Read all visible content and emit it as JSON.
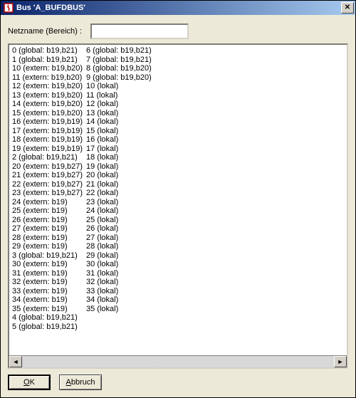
{
  "window": {
    "title": "Bus 'A_BUFDBUS'"
  },
  "form": {
    "netname_label": "Netzname (Bereich) :",
    "netname_value": ""
  },
  "list": {
    "col1": [
      "0 (global: b19,b21)",
      "1 (global: b19,b21)",
      "10 (extern: b19,b20)",
      "11 (extern: b19,b20)",
      "12 (extern: b19,b20)",
      "13 (extern: b19,b20)",
      "14 (extern: b19,b20)",
      "15 (extern: b19,b20)",
      "16 (extern: b19,b19)",
      "17 (extern: b19,b19)",
      "18 (extern: b19,b19)",
      "19 (extern: b19,b19)",
      "2 (global: b19,b21)",
      "20 (extern: b19,b27)",
      "21 (extern: b19,b27)",
      "22 (extern: b19,b27)",
      "23 (extern: b19,b27)",
      "24 (extern: b19)",
      "25 (extern: b19)",
      "26 (extern: b19)",
      "27 (extern: b19)",
      "28 (extern: b19)",
      "29 (extern: b19)",
      "3 (global: b19,b21)",
      "30 (extern: b19)",
      "31 (extern: b19)",
      "32 (extern: b19)",
      "33 (extern: b19)",
      "34 (extern: b19)",
      "35 (extern: b19)",
      "4 (global: b19,b21)",
      "5 (global: b19,b21)"
    ],
    "col2": [
      "6 (global: b19,b21)",
      "7 (global: b19,b21)",
      "8 (global: b19,b20)",
      "9 (global: b19,b20)",
      "10 (lokal)",
      "11 (lokal)",
      "12 (lokal)",
      "13 (lokal)",
      "14 (lokal)",
      "15 (lokal)",
      "16 (lokal)",
      "17 (lokal)",
      "18 (lokal)",
      "19 (lokal)",
      "20 (lokal)",
      "21 (lokal)",
      "22 (lokal)",
      "23 (lokal)",
      "24 (lokal)",
      "25 (lokal)",
      "26 (lokal)",
      "27 (lokal)",
      "28 (lokal)",
      "29 (lokal)",
      "30 (lokal)",
      "31 (lokal)",
      "32 (lokal)",
      "33 (lokal)",
      "34 (lokal)",
      "35 (lokal)"
    ]
  },
  "buttons": {
    "ok": "OK",
    "cancel": "Abbruch"
  },
  "icons": {
    "close": "✕",
    "scroll_left": "◄",
    "scroll_right": "►"
  }
}
